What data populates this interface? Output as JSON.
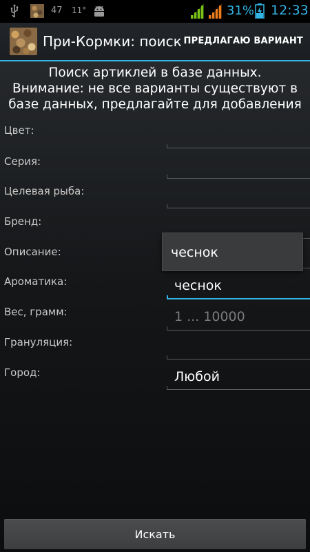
{
  "status_bar": {
    "notif_47": "47",
    "notif_11": "11°",
    "battery_percent": "31%",
    "time": "12:33",
    "icons": [
      "usb-icon",
      "photo-thumbnail-icon",
      "android-icon",
      "signal-icon",
      "signal-icon",
      "battery-icon"
    ]
  },
  "action_bar": {
    "title": "При-Кормки: поиск",
    "suggest_label": "ПРЕДЛАГАЮ ВАРИАНТ"
  },
  "info": {
    "line1": "Поиск артиклей в базе данных.",
    "line2": "Внимание: не все варианты существуют в",
    "line3": "базе данных, предлагайте для добавления"
  },
  "form": {
    "color_label": "Цвет:",
    "series_label": "Серия:",
    "target_fish_label": "Целевая рыба:",
    "brand_label": "Бренд:",
    "description_label": "Описание:",
    "aroma_label": "Ароматика:",
    "aroma_value": "чеснок",
    "weight_label": "Вес, грамм:",
    "weight_placeholder": "1 ... 10000",
    "granulation_label": "Грануляция:",
    "city_label": "Город:",
    "city_value": "Любой"
  },
  "dropdown": {
    "suggestion": "чеснок"
  },
  "search_button_label": "Искать",
  "colors": {
    "accent": "#33b5e5"
  }
}
